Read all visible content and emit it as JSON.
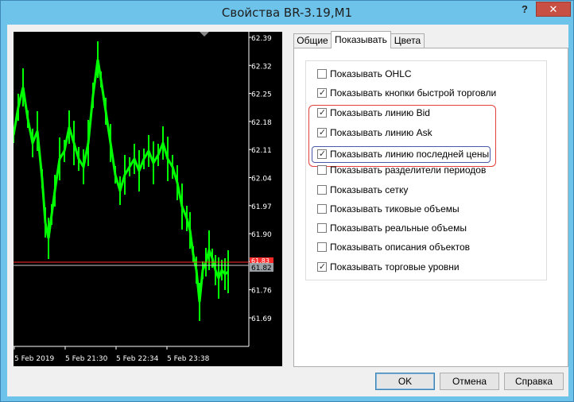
{
  "window": {
    "title": "Свойства BR-3.19,M1",
    "help_label": "?",
    "close_label": "✕"
  },
  "chart": {
    "price_labels": [
      "62.39",
      "62.32",
      "62.25",
      "62.18",
      "62.11",
      "62.04",
      "61.97",
      "61.90",
      "61.83",
      "61.76",
      "61.69"
    ],
    "time_labels": [
      "5 Feb 2019",
      "5 Feb 21:30",
      "5 Feb 22:34",
      "5 Feb 23:38"
    ],
    "bid_label": "61.82",
    "ask_label": "61.83",
    "bar_color": "#00ff00",
    "ask_line_color": "#ff2a2a",
    "bid_line_color": "#c8c8c8"
  },
  "tabs": [
    {
      "label": "Общие",
      "active": false
    },
    {
      "label": "Показывать",
      "active": true
    },
    {
      "label": "Цвета",
      "active": false
    }
  ],
  "options": [
    {
      "label": "Показывать OHLC",
      "checked": false
    },
    {
      "label": "Показывать кнопки быстрой торговли",
      "checked": true
    },
    {
      "label": "Показывать линию Bid",
      "checked": true
    },
    {
      "label": "Показывать линию Ask",
      "checked": true
    },
    {
      "label": "Показывать линию последней цены",
      "checked": true
    },
    {
      "label": "Показывать разделители периодов",
      "checked": false
    },
    {
      "label": "Показывать сетку",
      "checked": false
    },
    {
      "label": "Показывать тиковые объемы",
      "checked": false
    },
    {
      "label": "Показывать реальные объемы",
      "checked": false
    },
    {
      "label": "Показывать описания объектов",
      "checked": false
    },
    {
      "label": "Показывать торговые уровни",
      "checked": true
    }
  ],
  "buttons": {
    "ok": "OK",
    "cancel": "Отмена",
    "help": "Справка"
  }
}
